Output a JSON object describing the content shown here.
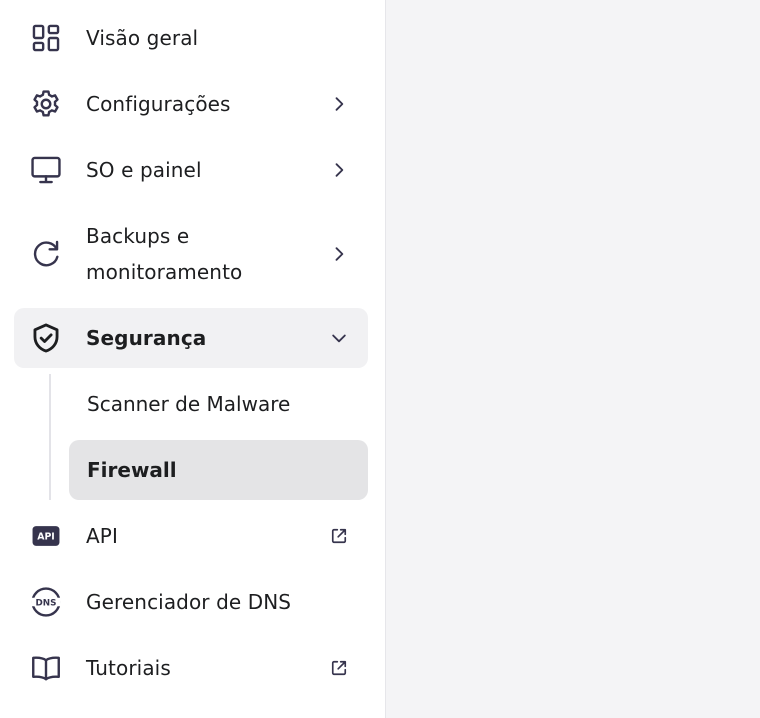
{
  "colors": {
    "sidebar_bg": "#ffffff",
    "content_bg": "#f4f4f6",
    "active_group_bg": "#f1f1f3",
    "active_item_bg": "#e4e4e6",
    "text": "#1d1e20",
    "icon": "#36344d"
  },
  "sidebar": {
    "items": [
      {
        "label": "Visão geral",
        "icon": "grid-icon",
        "trailing": "none"
      },
      {
        "label": "Configurações",
        "icon": "gear-icon",
        "trailing": "chevron-right-icon"
      },
      {
        "label": "SO e painel",
        "icon": "monitor-icon",
        "trailing": "chevron-right-icon"
      },
      {
        "label": "Backups e monitoramento",
        "icon": "refresh-icon",
        "trailing": "chevron-right-icon"
      },
      {
        "label": "Segurança",
        "icon": "shield-check-icon",
        "trailing": "chevron-down-icon",
        "expanded": true,
        "children": [
          {
            "label": "Scanner de Malware",
            "selected": false
          },
          {
            "label": "Firewall",
            "selected": true
          }
        ]
      },
      {
        "label": "API",
        "icon": "api-icon",
        "trailing": "external-link-icon"
      },
      {
        "label": "Gerenciador de DNS",
        "icon": "dns-icon",
        "trailing": "none"
      },
      {
        "label": "Tutoriais",
        "icon": "book-icon",
        "trailing": "external-link-icon"
      }
    ]
  }
}
